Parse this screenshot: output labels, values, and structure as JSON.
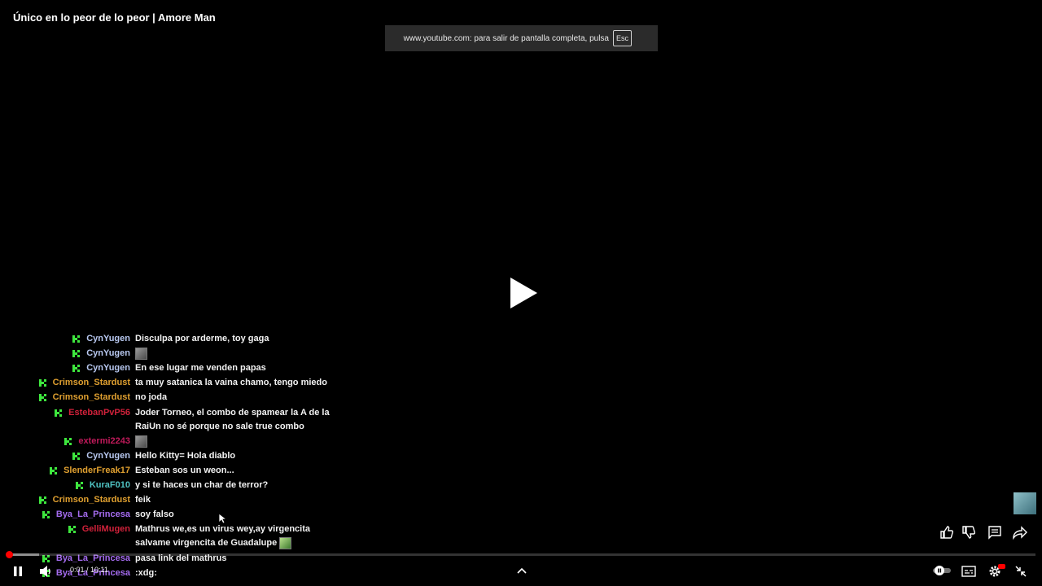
{
  "video": {
    "title": "Único en lo peor de lo peor | Amore Man"
  },
  "fullscreen_toast": {
    "message": "www.youtube.com: para salir de pantalla completa, pulsa",
    "key": "Esc"
  },
  "player": {
    "current_time": "0:01",
    "separator": " / ",
    "duration": "10:11",
    "progress_fraction": 0.001,
    "buffered_fraction": 0.032
  },
  "chat": {
    "badge_color": "#3ee83e",
    "messages": [
      {
        "user": "CynYugen",
        "color": "#b8c8f0",
        "text": "Disculpa por arderme, toy gaga",
        "emote": false
      },
      {
        "user": "CynYugen",
        "color": "#b8c8f0",
        "text": "",
        "emote": true
      },
      {
        "user": "CynYugen",
        "color": "#b8c8f0",
        "text": "En ese lugar me venden papas",
        "emote": false
      },
      {
        "user": "Crimson_Stardust",
        "color": "#e0a030",
        "text": "ta muy satanica la vaina chamo, tengo miedo",
        "emote": false
      },
      {
        "user": "Crimson_Stardust",
        "color": "#e0a030",
        "text": "no joda",
        "emote": false
      },
      {
        "user": "EstebanPvP56",
        "color": "#d0213a",
        "text": "Joder Torneo, el combo de spamear la A de la RaiUn no sé porque no sale true combo",
        "emote": false
      },
      {
        "user": "extermi2243",
        "color": "#c01a5a",
        "text": "",
        "emote": true
      },
      {
        "user": "CynYugen",
        "color": "#b8c8f0",
        "text": "Hello Kitty= Hola diablo",
        "emote": false
      },
      {
        "user": "SlenderFreak17",
        "color": "#e0a030",
        "text": "Esteban sos un weon...",
        "emote": false
      },
      {
        "user": "KuraF010",
        "color": "#4fc2c2",
        "text": "y si te haces un char de terror?",
        "emote": false
      },
      {
        "user": "Crimson_Stardust",
        "color": "#e0a030",
        "text": "feik",
        "emote": false
      },
      {
        "user": "Bya_La_Princesa",
        "color": "#a56cf0",
        "text": "soy falso",
        "emote": false
      },
      {
        "user": "GelliMugen",
        "color": "#d0213a",
        "text": "Mathrus we,es un virus wey,ay virgencita salvame virgencita de Guadalupe",
        "emote": true,
        "emote_style": "green"
      },
      {
        "user": "Bya_La_Princesa",
        "color": "#a56cf0",
        "text": "pasa link del mathrus",
        "emote": false
      },
      {
        "user": "Bya_La_Princesa",
        "color": "#a56cf0",
        "text": ":xdg:",
        "emote": false
      }
    ]
  },
  "icons": {
    "play": "play-icon",
    "pause": "pause-icon",
    "volume": "volume-icon",
    "chevron": "chevron-up-icon",
    "like": "thumbs-up-icon",
    "dislike": "thumbs-down-icon",
    "comments": "comment-icon",
    "share": "share-icon",
    "autoplay": "autoplay-toggle-icon",
    "captions": "captions-icon",
    "settings": "gear-icon",
    "exit_fullscreen": "exit-fullscreen-icon"
  },
  "colors": {
    "background": "#000000",
    "progress": "#ff0000",
    "settings_badge": "#ff0000"
  }
}
